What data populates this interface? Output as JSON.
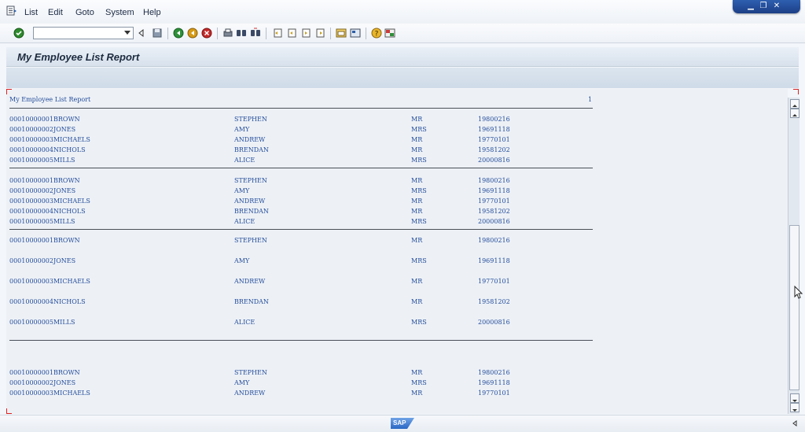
{
  "menubar": {
    "items": [
      "List",
      "Edit",
      "Goto",
      "System",
      "Help"
    ]
  },
  "window_controls": [
    "minimize-icon",
    "restore-icon",
    "close-icon"
  ],
  "toolbar": {
    "command_field_value": "",
    "icons": [
      "enter-icon",
      "back-icon",
      "save-icon",
      "back-green-icon",
      "exit-icon",
      "cancel-icon",
      "print-icon",
      "find-icon",
      "find-next-icon",
      "first-page-icon",
      "previous-page-icon",
      "next-page-icon",
      "last-page-icon",
      "create-session-icon",
      "shortcut-icon",
      "help-icon",
      "customize-layout-icon"
    ]
  },
  "screen_title": "My Employee List Report",
  "report": {
    "header_title": "My Employee List Report",
    "page_number": "1",
    "blocks": [
      {
        "spacing": "tight",
        "rows": [
          {
            "id": "00010000001BROWN",
            "first": "STEPHEN",
            "title": "MR",
            "date": "19800216"
          },
          {
            "id": "00010000002JONES",
            "first": "AMY",
            "title": "MRS",
            "date": "19691118"
          },
          {
            "id": "00010000003MICHAELS",
            "first": "ANDREW",
            "title": "MR",
            "date": "19770101"
          },
          {
            "id": "00010000004NICHOLS",
            "first": "BRENDAN",
            "title": "MR",
            "date": "19581202"
          },
          {
            "id": "00010000005MILLS",
            "first": "ALICE",
            "title": "MRS",
            "date": "20000816"
          }
        ]
      },
      {
        "spacing": "tight",
        "rows": [
          {
            "id": "00010000001BROWN",
            "first": "STEPHEN",
            "title": "MR",
            "date": "19800216"
          },
          {
            "id": "00010000002JONES",
            "first": "AMY",
            "title": "MRS",
            "date": "19691118"
          },
          {
            "id": "00010000003MICHAELS",
            "first": "ANDREW",
            "title": "MR",
            "date": "19770101"
          },
          {
            "id": "00010000004NICHOLS",
            "first": "BRENDAN",
            "title": "MR",
            "date": "19581202"
          },
          {
            "id": "00010000005MILLS",
            "first": "ALICE",
            "title": "MRS",
            "date": "20000816"
          }
        ]
      },
      {
        "spacing": "wide",
        "rows": [
          {
            "id": "00010000001BROWN",
            "first": "STEPHEN",
            "title": "MR",
            "date": "19800216"
          },
          {
            "id": "00010000002JONES",
            "first": "AMY",
            "title": "MRS",
            "date": "19691118"
          },
          {
            "id": "00010000003MICHAELS",
            "first": "ANDREW",
            "title": "MR",
            "date": "19770101"
          },
          {
            "id": "00010000004NICHOLS",
            "first": "BRENDAN",
            "title": "MR",
            "date": "19581202"
          },
          {
            "id": "00010000005MILLS",
            "first": "ALICE",
            "title": "MRS",
            "date": "20000816"
          }
        ]
      },
      {
        "spacing": "tight",
        "rows": [
          {
            "id": "00010000001BROWN",
            "first": "STEPHEN",
            "title": "MR",
            "date": "19800216"
          },
          {
            "id": "00010000002JONES",
            "first": "AMY",
            "title": "MRS",
            "date": "19691118"
          },
          {
            "id": "00010000003MICHAELS",
            "first": "ANDREW",
            "title": "MR",
            "date": "19770101"
          }
        ]
      }
    ]
  },
  "status_bar": {
    "logo_text": "SAP"
  },
  "colors": {
    "list_text": "#244c9a",
    "background": "#edf1f6",
    "rule": "#4a4f57"
  }
}
